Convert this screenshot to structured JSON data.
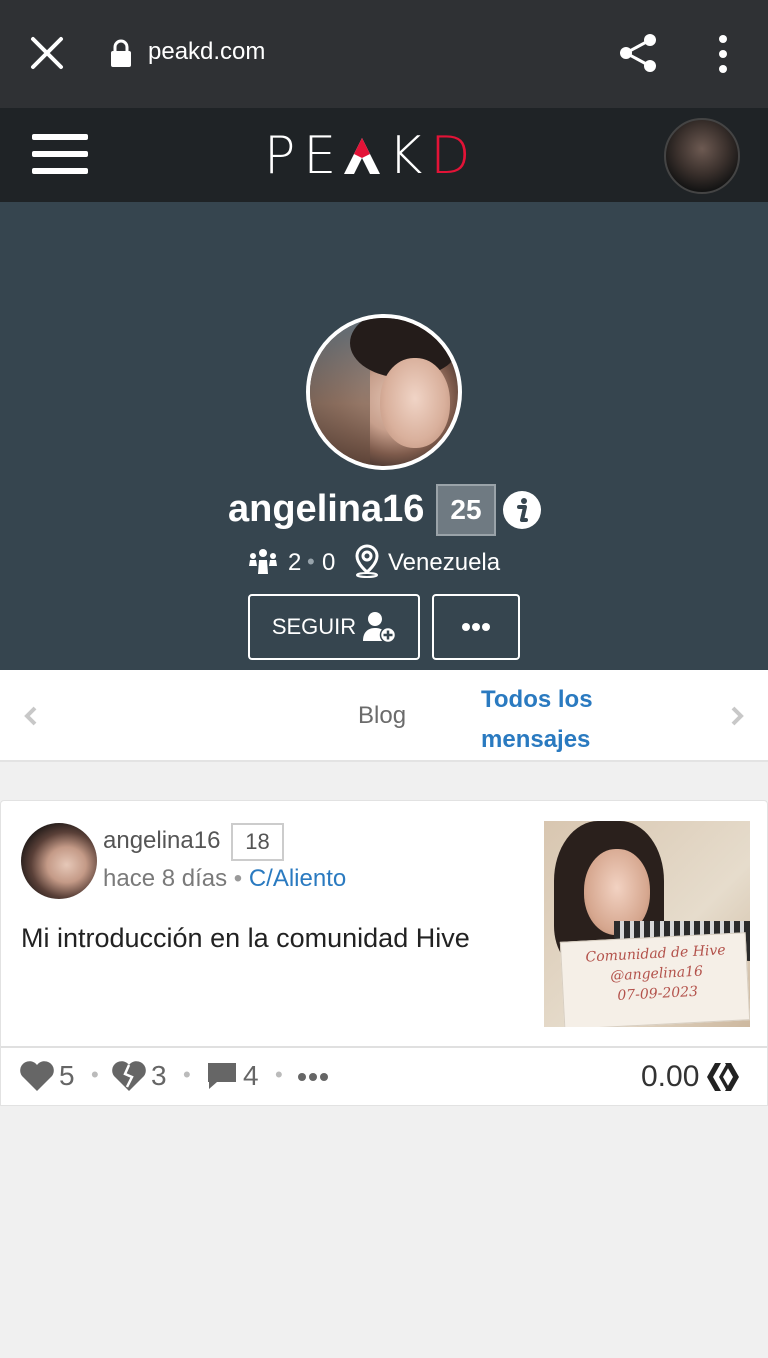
{
  "browser": {
    "url": "peakd.com"
  },
  "header": {
    "logo_text_a": "PE",
    "logo_text_b": "K",
    "logo_text_d": "D"
  },
  "profile": {
    "username": "angelina16",
    "reputation": "25",
    "followers": "2",
    "following": "0",
    "location": "Venezuela",
    "follow_label": "SEGUIR"
  },
  "tabs": {
    "blog": "Blog",
    "all_posts": "Todos los mensajes"
  },
  "post": {
    "author": "angelina16",
    "reputation": "18",
    "time_ago": "hace 8 días",
    "separator": "•",
    "community": "C/Aliento",
    "title": "Mi introducción en la comunidad Hive",
    "thumbnail_text_1": "Comunidad de Hive",
    "thumbnail_text_2": "@angelina16",
    "thumbnail_text_3": "07-09-2023",
    "upvotes": "5",
    "downvotes": "3",
    "comments": "4",
    "payout": "0.00"
  },
  "colors": {
    "accent_red": "#e31337",
    "link_blue": "#2a7ac0",
    "cover_bg": "#36454f"
  }
}
